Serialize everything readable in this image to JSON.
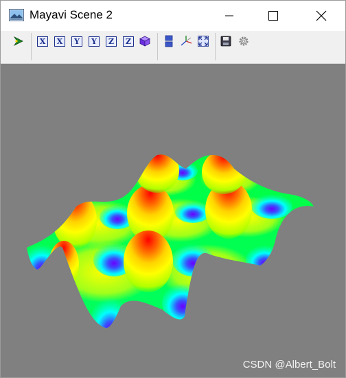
{
  "window": {
    "title": "Mayavi Scene 2",
    "controls": {
      "minimize": "minimize",
      "maximize": "maximize",
      "close": "close"
    }
  },
  "toolbar": {
    "buttons": [
      {
        "icon": "mayavi-pipeline-icon"
      },
      {
        "icon": "view-x-plus-icon",
        "label": "X"
      },
      {
        "icon": "view-x-minus-icon",
        "label": "X"
      },
      {
        "icon": "view-y-plus-icon",
        "label": "Y"
      },
      {
        "icon": "view-y-minus-icon",
        "label": "Y"
      },
      {
        "icon": "view-z-plus-icon",
        "label": "Z"
      },
      {
        "icon": "view-z-minus-icon",
        "label": "Z"
      },
      {
        "icon": "isometric-view-icon"
      },
      {
        "icon": "parallel-projection-icon"
      },
      {
        "icon": "show-axes-icon"
      },
      {
        "icon": "full-screen-icon"
      },
      {
        "icon": "save-icon"
      },
      {
        "icon": "settings-gear-icon"
      }
    ]
  },
  "scene": {
    "background_color": "#808080",
    "colormap": [
      "#6a00ff",
      "#00ffff",
      "#00ff00",
      "#ffff00",
      "#ff0000"
    ]
  },
  "watermark": "CSDN @Albert_Bolt"
}
